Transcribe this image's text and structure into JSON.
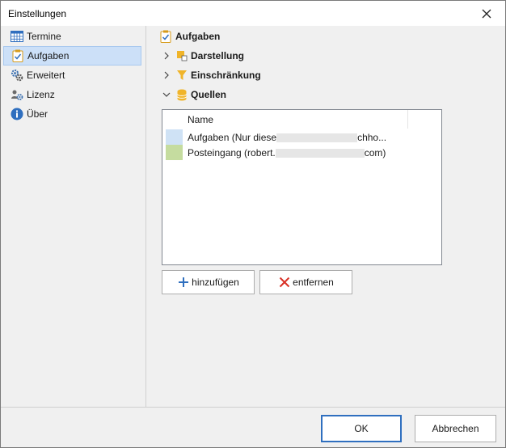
{
  "window": {
    "title": "Einstellungen"
  },
  "nav": {
    "items": [
      {
        "label": "Termine",
        "icon": "calendar-grid-icon"
      },
      {
        "label": "Aufgaben",
        "icon": "clipboard-check-icon"
      },
      {
        "label": "Erweitert",
        "icon": "gears-icon"
      },
      {
        "label": "Lizenz",
        "icon": "users-gear-icon"
      },
      {
        "label": "Über",
        "icon": "info-icon"
      }
    ],
    "selected_index": 1
  },
  "content": {
    "title": "Aufgaben",
    "tree": [
      {
        "label": "Darstellung",
        "expanded": false,
        "icon": "palette-icon"
      },
      {
        "label": "Einschränkung",
        "expanded": false,
        "icon": "filter-icon"
      },
      {
        "label": "Quellen",
        "expanded": true,
        "icon": "database-icon"
      }
    ],
    "list": {
      "header": "Name",
      "rows": [
        {
          "label": "Aufgaben (Nur diese",
          "tail": "chho...",
          "color": "#cfe2f5"
        },
        {
          "label": "Posteingang (robert.",
          "tail": "com)",
          "color": "#c5dc9f"
        }
      ]
    },
    "buttons": {
      "add": "hinzufügen",
      "remove": "entfernen"
    }
  },
  "footer": {
    "ok": "OK",
    "cancel": "Abbrechen"
  },
  "colors": {
    "accent": "#2f6fbf",
    "selected_bg": "#cce0f8",
    "icon_yellow": "#f0b429",
    "remove_red": "#d93025",
    "add_blue": "#2f6fbf"
  }
}
